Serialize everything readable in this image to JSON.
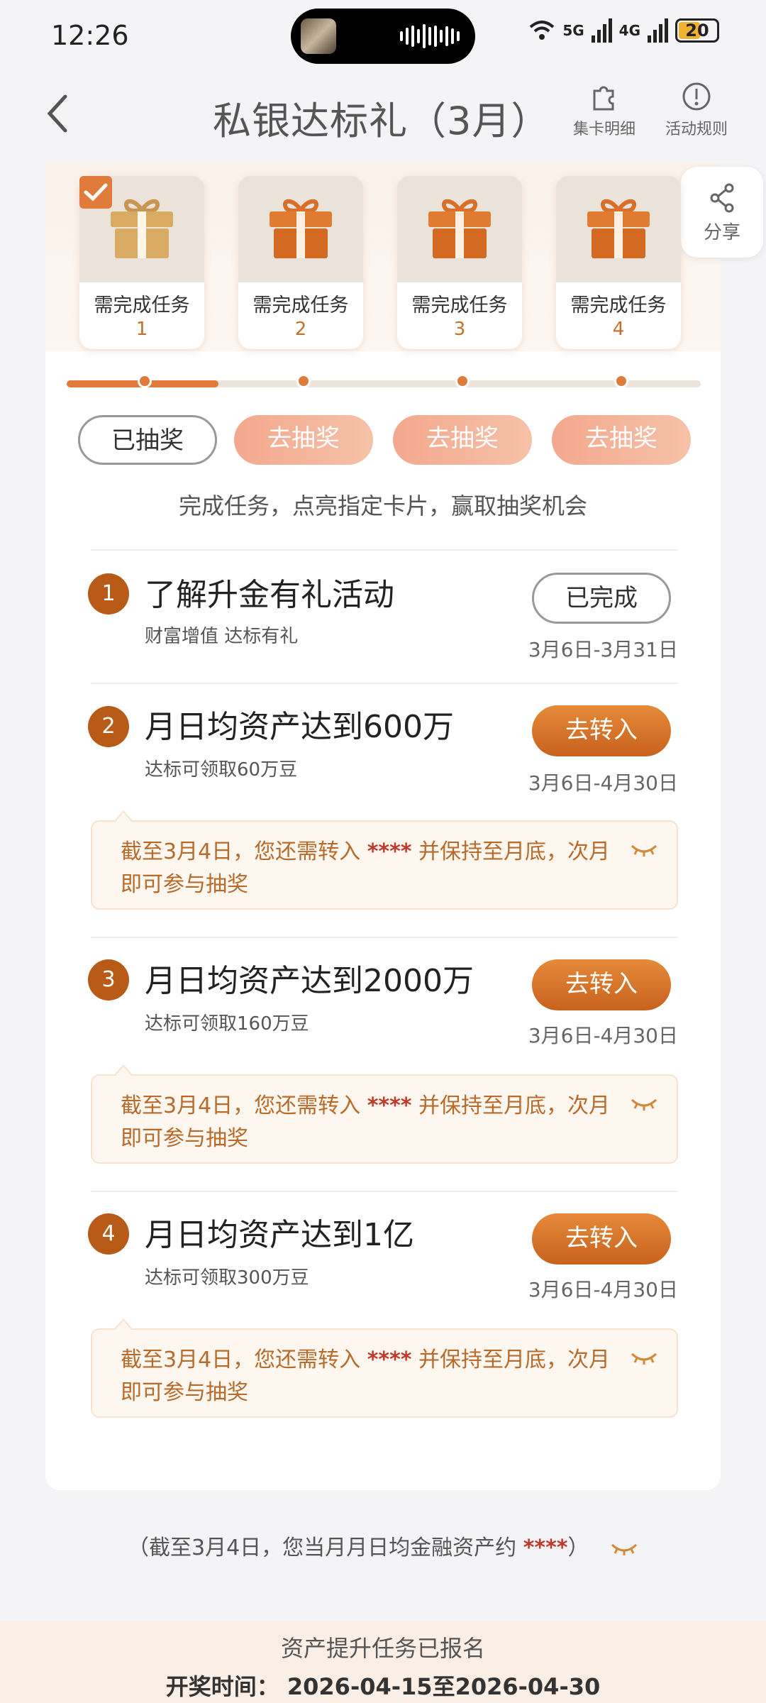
{
  "status_bar": {
    "time": "12:26",
    "network1": "5G",
    "network2": "4G",
    "battery": "20",
    "battery_color": "#f0b030"
  },
  "nav": {
    "title": "私银达标礼（3月）",
    "card_detail": "集卡明细",
    "rules": "活动规则",
    "share": "分享"
  },
  "gifts": [
    {
      "label": "需完成任务",
      "num": "1",
      "checked": true
    },
    {
      "label": "需完成任务",
      "num": "2",
      "checked": false
    },
    {
      "label": "需完成任务",
      "num": "3",
      "checked": false
    },
    {
      "label": "需完成任务",
      "num": "4",
      "checked": false
    }
  ],
  "progress": {
    "completed_stage": 1,
    "total_stages": 4
  },
  "draw_buttons": [
    "已抽奖",
    "去抽奖",
    "去抽奖",
    "去抽奖"
  ],
  "hint": "完成任务，点亮指定卡片，赢取抽奖机会",
  "tasks": [
    {
      "num": "1",
      "title": "了解升金有礼活动",
      "subtitle": "财富增值 达标有礼",
      "button": "已完成",
      "date": "3月6日-3月31日"
    },
    {
      "num": "2",
      "title": "月日均资产达到600万",
      "subtitle": "达标可领取60万豆",
      "button": "去转入",
      "date": "3月6日-4月30日",
      "tip_a": "截至3月4日，您还需转入 ",
      "tip_mask": "****",
      "tip_b": " 并保持至月底，次月即可参与抽奖"
    },
    {
      "num": "3",
      "title": "月日均资产达到2000万",
      "subtitle": "达标可领取160万豆",
      "button": "去转入",
      "date": "3月6日-4月30日",
      "tip_a": "截至3月4日，您还需转入 ",
      "tip_mask": "****",
      "tip_b": " 并保持至月底，次月即可参与抽奖"
    },
    {
      "num": "4",
      "title": "月日均资产达到1亿",
      "subtitle": "达标可领取300万豆",
      "button": "去转入",
      "date": "3月6日-4月30日",
      "tip_a": "截至3月4日，您还需转入 ",
      "tip_mask": "****",
      "tip_b": " 并保持至月底，次月即可参与抽奖"
    }
  ],
  "footer": {
    "note_a": "（截至3月4日，您当月月日均金融资产约 ",
    "note_mask": "****",
    "note_b": "）"
  },
  "banner": {
    "line1": "资产提升任务已报名",
    "line2": "开奖时间： 2026-04-15至2026-04-30"
  },
  "colors": {
    "accent": "#e07b3c",
    "task_badge": "#b85a18",
    "mask": "#c0392b"
  }
}
